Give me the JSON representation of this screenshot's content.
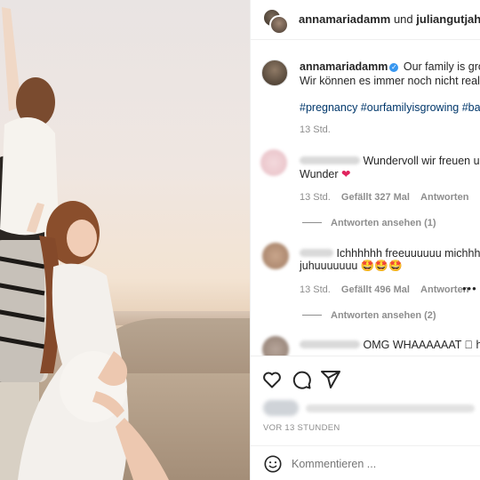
{
  "header": {
    "user1": "annamariadamm",
    "separator": "und",
    "user2": "juliangutjahr"
  },
  "caption": {
    "username": "annamariadamm",
    "text_line1": "Our family is growing",
    "text_line2": "Wir können es immer noch nicht realisie",
    "hashtags": "#pregnancy #ourfamilyisgrowing #baby",
    "time": "13 Std."
  },
  "comments": [
    {
      "text_line1": "Wundervoll wir freuen un",
      "text_line2": "Wunder",
      "emoji": "❤",
      "time": "13 Std.",
      "likes": "Gefällt 327 Mal",
      "reply": "Antworten",
      "view_replies": "Antworten ansehen (1)"
    },
    {
      "text_line1": "Ichhhhhh freeuuuuuu michhh",
      "text_line2": "juhuuuuuuu",
      "emoji": "🤩🤩🤩",
      "time": "13 Std.",
      "likes": "Gefällt 496 Mal",
      "reply": "Antworten",
      "more": "•••",
      "view_replies": "Antworten ansehen (2)"
    },
    {
      "text_line1": "OMG WHAAAAAAT ⃞ he"
    }
  ],
  "footer": {
    "date": "VOR 13 STUNDEN",
    "comment_placeholder": "Kommentieren ..."
  },
  "icons": [
    "heart-icon",
    "comment-icon",
    "share-icon",
    "emoji-icon",
    "verified-icon",
    "more-icon"
  ],
  "colors": {
    "hashtag": "#00376b",
    "verified": "#3897f0",
    "secondary_text": "#8e8e8e"
  }
}
